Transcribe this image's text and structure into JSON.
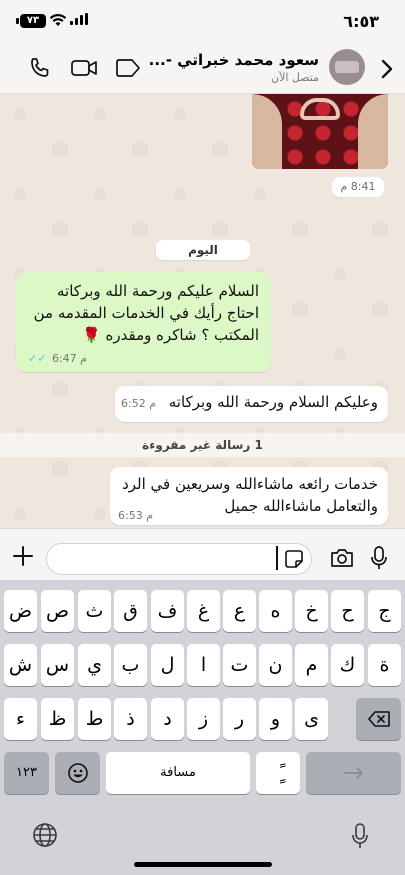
{
  "status_bar": {
    "time": "٦:٥٣",
    "battery": "٧٣",
    "icons": [
      "wifi-icon",
      "signal-icon"
    ]
  },
  "header": {
    "contact_name": "سعود محمد خبراتي -...",
    "contact_status": "متصل الآن",
    "icons": [
      "chevron-left-icon",
      "avatar",
      "video-call-icon",
      "phone-icon",
      "tag-icon"
    ]
  },
  "chat": {
    "image_time": "8:41 م",
    "date_divider": "اليوم",
    "messages": [
      {
        "direction": "out",
        "lines": [
          "السلام عليكم ورحمة الله وبركاته",
          "احتاج رأيك في الخدمات المقدمه من",
          "المكتب ؟ شاكره ومقدره 🌹"
        ],
        "time": "6:47 م",
        "status": "read"
      },
      {
        "direction": "in",
        "lines": [
          "وعليكم السلام ورحمة الله وبركاته"
        ],
        "time": "6:52 م"
      },
      {
        "direction": "in",
        "lines": [
          "خدمات رائعه ماشاءالله وسريعين في الرد",
          "والتعامل ماشاءالله جميل"
        ],
        "time": "6:53 م"
      }
    ],
    "unread_label": "1 رسالة غير مقروءة"
  },
  "input_bar": {
    "placeholder": "",
    "icons": [
      "plus-icon",
      "sticker-icon",
      "camera-icon",
      "microphone-icon"
    ]
  },
  "keyboard": {
    "rows": [
      [
        "ض",
        "ص",
        "ث",
        "ق",
        "ف",
        "غ",
        "ع",
        "ه",
        "خ",
        "ح",
        "ج"
      ],
      [
        "ش",
        "س",
        "ي",
        "ب",
        "ل",
        "ا",
        "ت",
        "ن",
        "م",
        "ك",
        "ة"
      ],
      [
        "ء",
        "ظ",
        "ط",
        "ذ",
        "د",
        "ز",
        "ر",
        "و",
        "ى"
      ]
    ],
    "numbers_key": "١٢٣",
    "space_key": "مسافة",
    "tanween_key": "ًٍ",
    "icons": [
      "backspace-icon",
      "emoji-icon",
      "return-icon",
      "globe-icon",
      "dictation-icon"
    ]
  }
}
